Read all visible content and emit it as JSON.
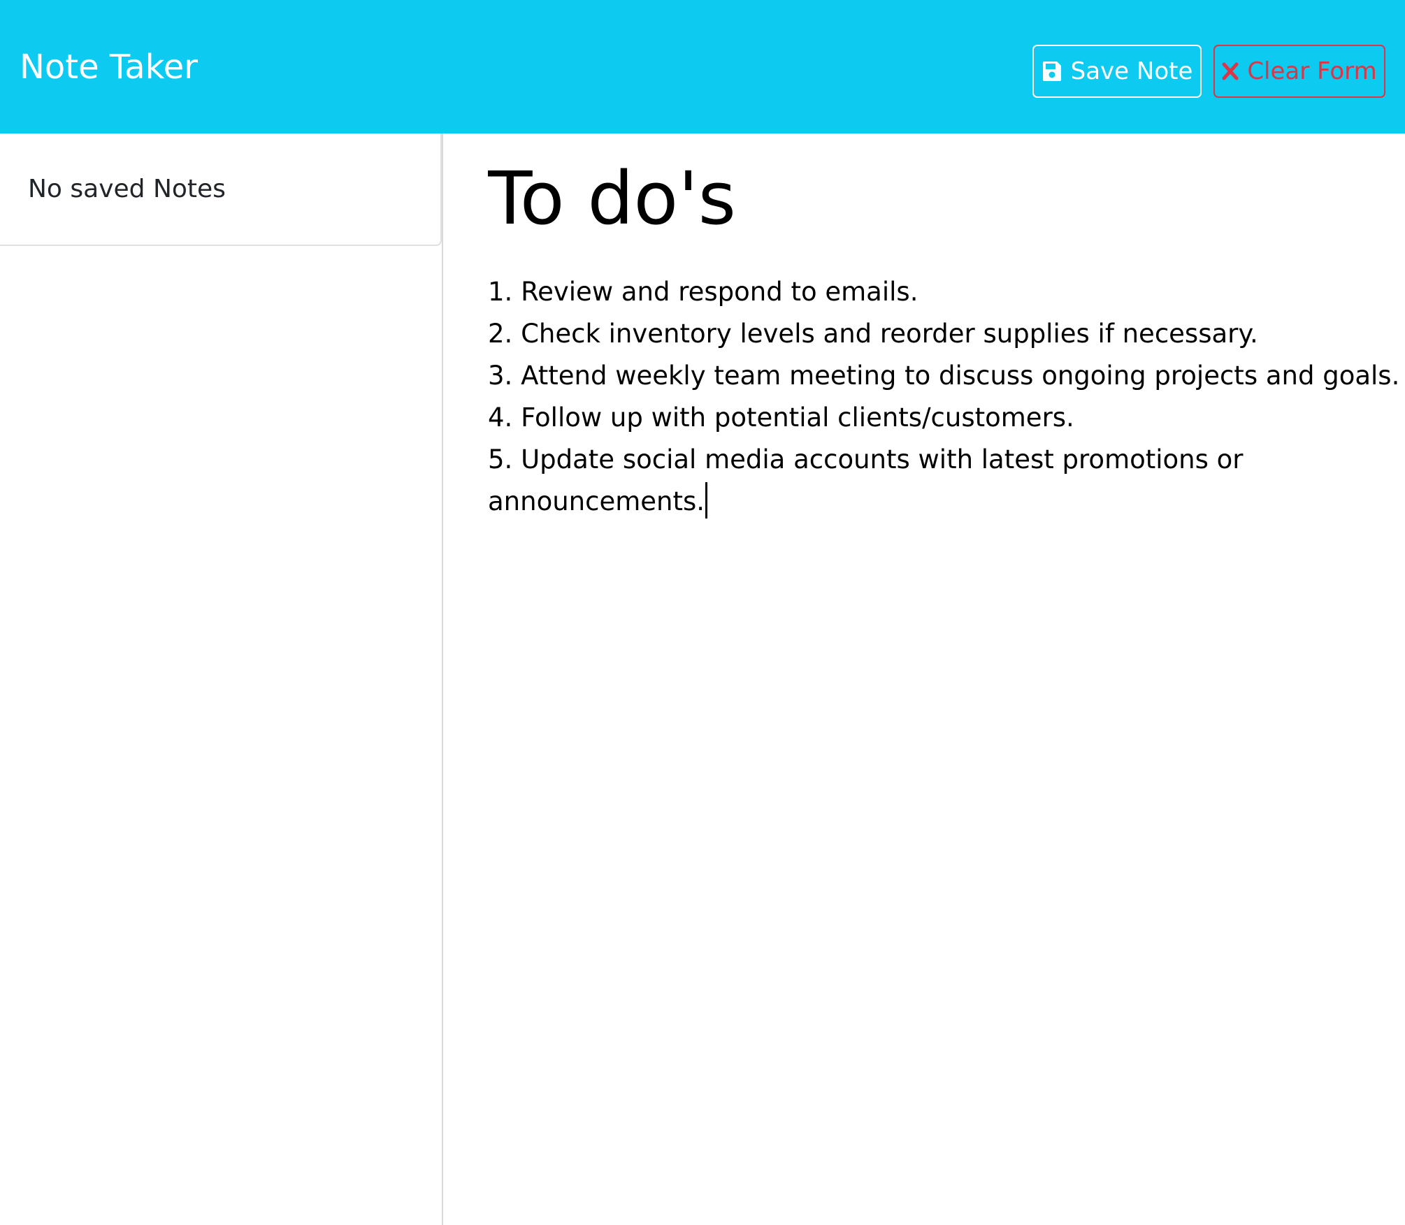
{
  "app": {
    "title": "Note Taker"
  },
  "toolbar": {
    "save_label": "Save Note",
    "save_icon": "floppy-disk-icon",
    "clear_label": "Clear Form",
    "clear_icon": "x-icon"
  },
  "sidebar": {
    "empty_message": "No saved Notes"
  },
  "editor": {
    "title_value": "To do's",
    "body_lines": [
      "1. Review and respond to emails.",
      "2. Check inventory levels and reorder supplies if necessary.",
      "3. Attend weekly team meeting to discuss ongoing projects and goals.",
      "4. Follow up with potential clients/customers.",
      "5. Update social media accounts with latest promotions or",
      "announcements."
    ]
  },
  "colors": {
    "navbar": "#0dcaf0",
    "save_button": "#ffffff",
    "clear_button": "#dc3545"
  }
}
